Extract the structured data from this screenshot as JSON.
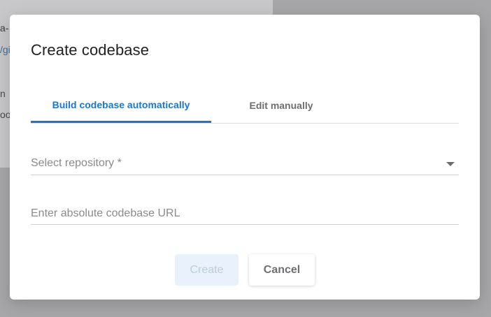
{
  "background": {
    "fragments": [
      "a-",
      "/gi",
      "n",
      "oo"
    ]
  },
  "dialog": {
    "title": "Create codebase",
    "tabs": [
      {
        "label": "Build codebase automatically",
        "active": true
      },
      {
        "label": "Edit manually",
        "active": false
      }
    ],
    "repository_select": {
      "placeholder": "Select repository *"
    },
    "url_input": {
      "placeholder": "Enter absolute codebase URL",
      "value": ""
    },
    "buttons": {
      "create_label": "Create",
      "cancel_label": "Cancel"
    }
  },
  "colors": {
    "accent": "#1976d2",
    "create_disabled_bg": "#e8f1fc",
    "overlay": "#a7a7a9"
  },
  "icons": {
    "dropdown": "chevron-down-icon"
  }
}
